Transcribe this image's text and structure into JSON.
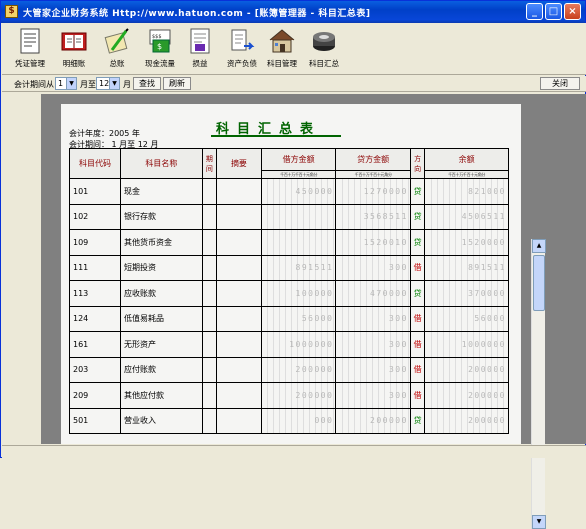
{
  "window": {
    "title": "大管家企业财务系统 Http://www.hatuon.com - [账簿管理器 - 科目汇总表]"
  },
  "toolbar": {
    "items": [
      {
        "label": "凭证管理",
        "icon": "voucher-icon"
      },
      {
        "label": "明细账",
        "icon": "ledger-icon"
      },
      {
        "label": "总账",
        "icon": "general-ledger-icon"
      },
      {
        "label": "现金流量",
        "icon": "cashflow-icon"
      },
      {
        "label": "损益",
        "icon": "profit-loss-icon"
      },
      {
        "label": "资产负债",
        "icon": "balance-sheet-icon"
      },
      {
        "label": "科目管理",
        "icon": "house-icon"
      },
      {
        "label": "科目汇总",
        "icon": "summary-icon"
      }
    ]
  },
  "filter": {
    "label_from": "会计期间从",
    "from_value": "1",
    "label_to": "月至",
    "to_value": "12",
    "label_month": "月",
    "query_label": "查找",
    "refresh_label": "刷新",
    "close_label": "关闭"
  },
  "report": {
    "title": "科目汇总表",
    "year_line": "会计年度：2005 年",
    "period_line": "会计期间：  1   月至   12  月",
    "col_code": "科目代码",
    "col_name": "科目名称",
    "col_period": "期间",
    "col_summary": "摘要",
    "col_debit": "借方金额",
    "col_credit": "贷方金额",
    "col_dir": "方向",
    "col_balance": "余额",
    "digit_header": "千百十万千百十元角分",
    "rows": [
      {
        "code": "101",
        "name": "现金",
        "debit": "450000",
        "credit": "1270000",
        "dir": "贷",
        "balance": "821000"
      },
      {
        "code": "102",
        "name": "银行存款",
        "debit": "",
        "credit": "3568511",
        "dir": "贷",
        "balance": "4506511"
      },
      {
        "code": "109",
        "name": "其他货币资金",
        "debit": "",
        "credit": "1520010",
        "dir": "贷",
        "balance": "1520000"
      },
      {
        "code": "111",
        "name": "短期投资",
        "debit": "891511",
        "credit": "300",
        "dir": "借",
        "balance": "891511"
      },
      {
        "code": "113",
        "name": "应收账款",
        "debit": "100000",
        "credit": "470000",
        "dir": "贷",
        "balance": "370000"
      },
      {
        "code": "124",
        "name": "低值易耗品",
        "debit": "56000",
        "credit": "300",
        "dir": "借",
        "balance": "56000"
      },
      {
        "code": "161",
        "name": "无形资产",
        "debit": "1000000",
        "credit": "300",
        "dir": "借",
        "balance": "1000000"
      },
      {
        "code": "203",
        "name": "应付账款",
        "debit": "200000",
        "credit": "300",
        "dir": "借",
        "balance": "200000"
      },
      {
        "code": "209",
        "name": "其他应付款",
        "debit": "200000",
        "credit": "300",
        "dir": "借",
        "balance": "200000"
      },
      {
        "code": "501",
        "name": "营业收入",
        "debit": "000",
        "credit": "200000",
        "dir": "贷",
        "balance": "200000"
      }
    ]
  },
  "colors": {
    "accent_green": "#006400",
    "credit_dir": "#008000",
    "debit_dir": "#c00000"
  }
}
